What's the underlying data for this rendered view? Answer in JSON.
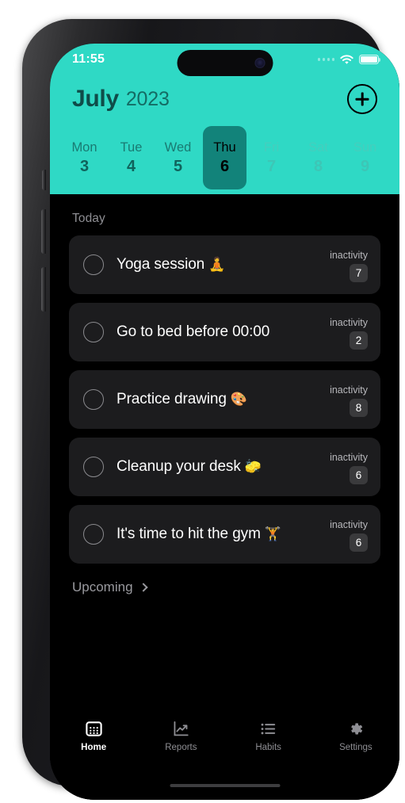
{
  "status_bar": {
    "time": "11:55",
    "signal_icon": "signal-dots-icon",
    "wifi_icon": "wifi-icon",
    "battery_icon": "battery-full-icon"
  },
  "header": {
    "month": "July",
    "year": "2023",
    "add_button_icon": "plus-circle-icon",
    "background_color": "#2fd9c5",
    "selected_day_color": "#12837a"
  },
  "week": [
    {
      "name": "Mon",
      "num": "3",
      "state": "past"
    },
    {
      "name": "Tue",
      "num": "4",
      "state": "past"
    },
    {
      "name": "Wed",
      "num": "5",
      "state": "past"
    },
    {
      "name": "Thu",
      "num": "6",
      "state": "selected"
    },
    {
      "name": "Fri",
      "num": "7",
      "state": "future"
    },
    {
      "name": "Sat",
      "num": "8",
      "state": "future"
    },
    {
      "name": "Sun",
      "num": "9",
      "state": "future"
    }
  ],
  "today": {
    "label": "Today",
    "tasks": [
      {
        "title": "Yoga session",
        "emoji": "🧘",
        "meta_label": "inactivity",
        "count": "7"
      },
      {
        "title": "Go to bed before 00:00",
        "emoji": "",
        "meta_label": "inactivity",
        "count": "2"
      },
      {
        "title": "Practice drawing",
        "emoji": "🎨",
        "meta_label": "inactivity",
        "count": "8"
      },
      {
        "title": "Cleanup your desk",
        "emoji": "🧽",
        "meta_label": "inactivity",
        "count": "6"
      },
      {
        "title": "It's time to hit the gym",
        "emoji": "🏋️",
        "meta_label": "inactivity",
        "count": "6"
      }
    ]
  },
  "upcoming": {
    "label": "Upcoming",
    "chevron_icon": "chevron-right-icon"
  },
  "tabbar": {
    "tabs": [
      {
        "label": "Home",
        "icon": "calendar-icon",
        "active": true
      },
      {
        "label": "Reports",
        "icon": "chart-line-up-icon",
        "active": false
      },
      {
        "label": "Habits",
        "icon": "list-icon",
        "active": false
      },
      {
        "label": "Settings",
        "icon": "gear-icon",
        "active": false
      }
    ]
  }
}
